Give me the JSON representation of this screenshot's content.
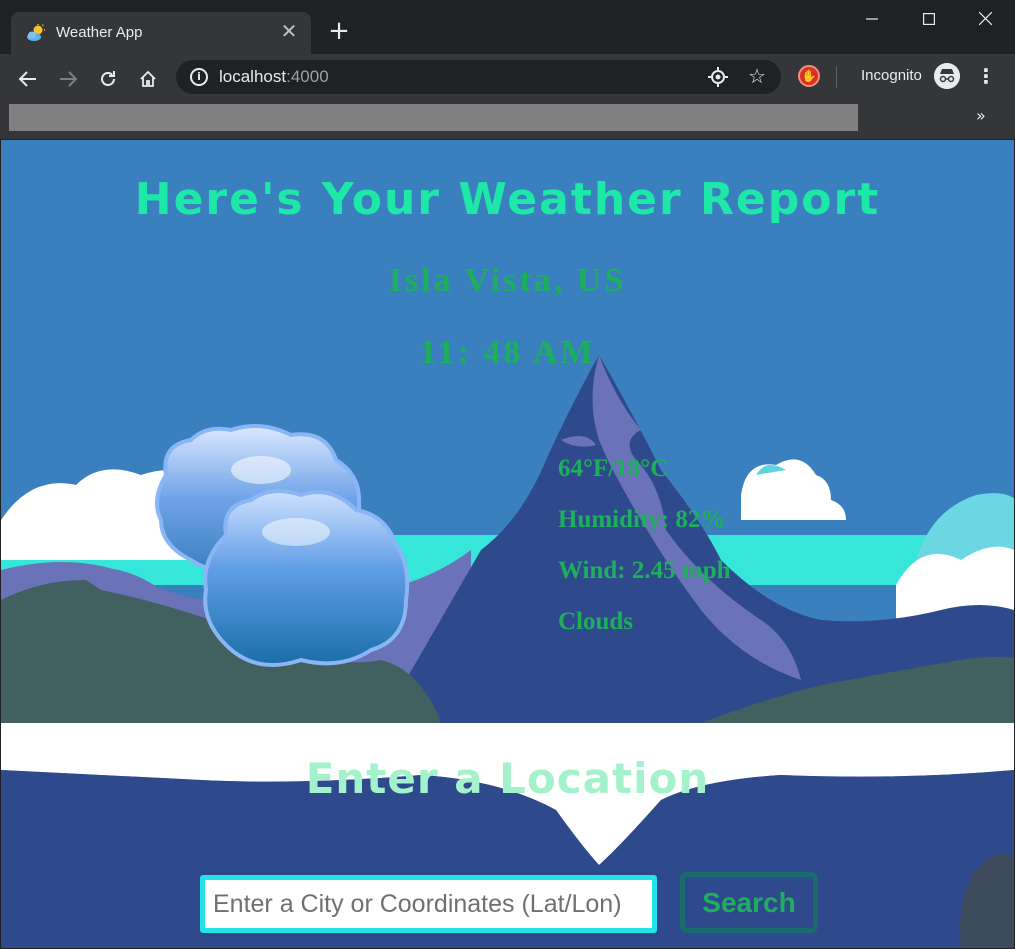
{
  "browser": {
    "tab_title": "Weather App",
    "url_host": "localhost",
    "url_port": ":4000",
    "profile_label": "Incognito",
    "icons": {
      "favicon": "weather-partly-cloudy-icon",
      "tab_close": "close-icon",
      "new_tab": "plus-icon",
      "back": "arrow-left-icon",
      "forward": "arrow-right-icon",
      "reload": "reload-icon",
      "home": "home-icon",
      "site_info": "info-icon",
      "location": "location-target-icon",
      "bookmark": "star-icon",
      "extension": "stop-hand-icon",
      "incognito": "incognito-icon",
      "menu": "more-vert-icon",
      "bookmarks_overflow": "chevron-double-right-icon"
    }
  },
  "report": {
    "title": "Here's Your Weather Report",
    "location": "Isla Vista, US",
    "time": "11: 48 AM",
    "temperature": "64°F/18°C",
    "humidity": "Humidity: 82%",
    "wind": "Wind: 2.45 mph",
    "condition": "Clouds",
    "condition_icon": "clouds-icon"
  },
  "search": {
    "heading": "Enter a Location",
    "placeholder": "Enter a City or Coordinates (Lat/Lon)",
    "value": "",
    "button_label": "Search"
  },
  "colors": {
    "title": "#1ee8a8",
    "text_green": "#1daf5c",
    "subtitle": "#a4f2cc",
    "input_border": "#22e3e8",
    "button_border": "#1a6b6b",
    "sky": "#3a80bf",
    "mountain": "#2e4a8c"
  }
}
